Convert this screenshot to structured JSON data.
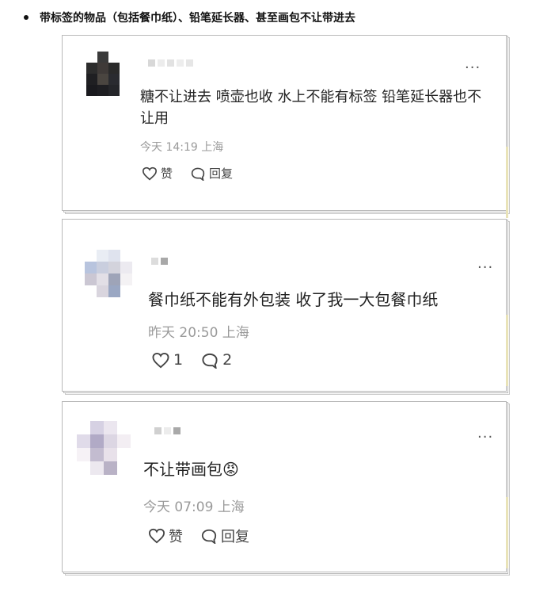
{
  "bullet_text": "带标签的物品（包括餐巾纸）、铅笔延长器、甚至画包不让带进去",
  "comments": [
    {
      "text": "糖不让进去 喷壶也收 水上不能有标签 铅笔延长器也不让用",
      "time": "今天 14:19 上海",
      "like_label": "赞",
      "reply_label": "回复",
      "more": "···"
    },
    {
      "text": "餐巾纸不能有外包装 收了我一大包餐巾纸",
      "time": "昨天 20:50 上海",
      "like_label": "1",
      "reply_label": "2",
      "more": "···"
    },
    {
      "text": "不让带画包",
      "emoji": "😡",
      "time": "今天 07:09 上海",
      "like_label": "赞",
      "reply_label": "回复",
      "more": "···"
    }
  ],
  "icons": {
    "like": "heart-outline-icon",
    "reply": "speech-bubble-icon",
    "more": "more-dots-icon"
  }
}
